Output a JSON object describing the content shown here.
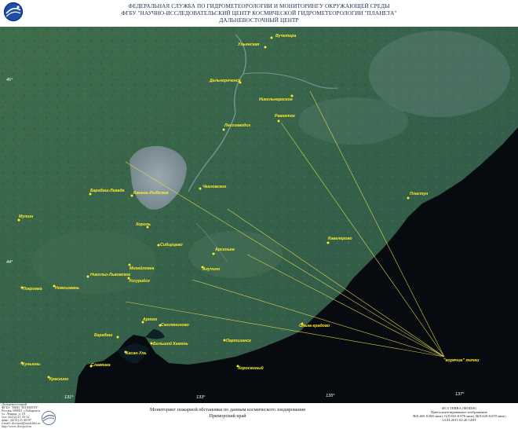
{
  "header": {
    "line1": "ФЕДЕРАЛЬНАЯ СЛУЖБА ПО ГИДРОМЕТЕОРОЛОГИИ И МОНИТОРИНГУ ОКРУЖАЮЩЕЙ СРЕДЫ",
    "line2": "ФГБУ \"НАУЧНО-ИССЛЕДОВАТЕЛЬСКИЙ ЦЕНТР КОСМИЧЕСКОЙ ГИДРОМЕТЕОРОЛОГИИ \"ПЛАНЕТА\"",
    "line3": "ДАЛЬНЕВОСТОЧНЫЙ ЦЕНТР"
  },
  "cities": [
    {
      "name": "Вучетора"
    },
    {
      "name": "Ульянская"
    },
    {
      "name": "Дальнереченск"
    },
    {
      "name": "Никольнереское"
    },
    {
      "name": "Рвангтое"
    },
    {
      "name": "Лесозаводск"
    },
    {
      "name": "Барабаш-Левада"
    },
    {
      "name": "Камень-Рыболов"
    },
    {
      "name": "Чкаловское"
    },
    {
      "name": "Пластун"
    },
    {
      "name": "Мутин"
    },
    {
      "name": "Хороль"
    },
    {
      "name": "Сибирцево"
    },
    {
      "name": "Кавалерово"
    },
    {
      "name": "Арсеньев"
    },
    {
      "name": "Михайловка"
    },
    {
      "name": "Анучино"
    },
    {
      "name": "Никольо-Львовское"
    },
    {
      "name": "Уссурийск"
    },
    {
      "name": "Покровка"
    },
    {
      "name": "Новоизвань"
    },
    {
      "name": "Ольга-градово"
    },
    {
      "name": "Артем"
    },
    {
      "name": "Смоляниново"
    },
    {
      "name": "Барабаш"
    },
    {
      "name": "Большой Камень"
    },
    {
      "name": "Партизанск"
    },
    {
      "name": "Славянка"
    },
    {
      "name": "Хасан-Уль"
    },
    {
      "name": "Хуньюнь"
    },
    {
      "name": "Краскино"
    },
    {
      "name": "Хоросвиный"
    }
  ],
  "latitudes": [
    "46°",
    "44°"
  ],
  "longitudes": [
    "131°",
    "133°",
    "135°",
    "137°"
  ],
  "hotspot_label": "\"горячие\" точки",
  "footer": {
    "left": [
      "Дальневосточный",
      "ФГБУ \"НИЦ \"ПЛАНЕТА\"",
      "Россия, 680011 г.Хабаровск",
      "ул. Ленина, д. 18",
      "тел: (4212) 21-43-12",
      "факс: (4212) 21-40-97",
      "e-mail: dvrcpod@mail.khv.ru",
      "http://www.dvrcpod.ru"
    ],
    "center1": "Мониторинг пожарной обстановки по данным космического зондирования",
    "center2": "Приморский край",
    "right1": "ИСЗ TERRA (MODIS)",
    "right2": "Цветосинтезированное изображение",
    "right3": "R(0.465-0.865 мкм), G(0.841-0.876 мкм), B(0.620-0.670 мкм)",
    "right4": "14.04.2015 02:26 GMT"
  },
  "colors": {
    "land": "#3d6a4a",
    "sea": "#070b10",
    "lake": "#8a9aa3",
    "label": "#ffeb2a",
    "fire_line": "#f0e050"
  }
}
